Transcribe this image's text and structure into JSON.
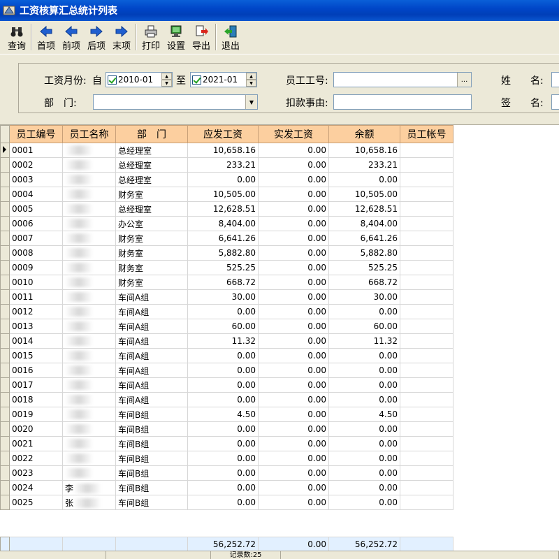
{
  "window": {
    "title": "工资核算汇总统计列表"
  },
  "toolbar": {
    "buttons": [
      {
        "label": "查询",
        "icon": "binoculars-icon"
      },
      {
        "label": "首项",
        "icon": "arrow-left-icon"
      },
      {
        "label": "前项",
        "icon": "arrow-left-icon"
      },
      {
        "label": "后项",
        "icon": "arrow-right-icon"
      },
      {
        "label": "末项",
        "icon": "arrow-right-icon"
      },
      {
        "label": "打印",
        "icon": "printer-icon"
      },
      {
        "label": "设置",
        "icon": "monitor-icon"
      },
      {
        "label": "导出",
        "icon": "export-icon"
      },
      {
        "label": "退出",
        "icon": "exit-door-icon"
      }
    ]
  },
  "filter": {
    "month_label": "工资月份:",
    "from_label": "自",
    "from_value": "2010-01",
    "to_label": "至",
    "to_value": "2021-01",
    "dept_label": "部　门:",
    "dept_value": "",
    "emp_no_label": "员工工号:",
    "emp_no_value": "",
    "deduct_label": "扣款事由:",
    "deduct_value": "",
    "name_label": "姓　　名:",
    "sign_label": "签　　名:",
    "dots": "..."
  },
  "table": {
    "columns": [
      "员工编号",
      "员工名称",
      "部　门",
      "应发工资",
      "实发工资",
      "余额",
      "员工帐号"
    ],
    "rows": [
      {
        "id": "0001",
        "name": "",
        "dept": "总经理室",
        "payable": "10,658.16",
        "paid": "0.00",
        "balance": "10,658.16"
      },
      {
        "id": "0002",
        "name": "",
        "dept": "总经理室",
        "payable": "233.21",
        "paid": "0.00",
        "balance": "233.21"
      },
      {
        "id": "0003",
        "name": "",
        "dept": "总经理室",
        "payable": "0.00",
        "paid": "0.00",
        "balance": "0.00"
      },
      {
        "id": "0004",
        "name": "",
        "dept": "财务室",
        "payable": "10,505.00",
        "paid": "0.00",
        "balance": "10,505.00"
      },
      {
        "id": "0005",
        "name": "",
        "dept": "总经理室",
        "payable": "12,628.51",
        "paid": "0.00",
        "balance": "12,628.51"
      },
      {
        "id": "0006",
        "name": "",
        "dept": "办公室",
        "payable": "8,404.00",
        "paid": "0.00",
        "balance": "8,404.00"
      },
      {
        "id": "0007",
        "name": "",
        "dept": "财务室",
        "payable": "6,641.26",
        "paid": "0.00",
        "balance": "6,641.26"
      },
      {
        "id": "0008",
        "name": "",
        "dept": "财务室",
        "payable": "5,882.80",
        "paid": "0.00",
        "balance": "5,882.80"
      },
      {
        "id": "0009",
        "name": "",
        "dept": "财务室",
        "payable": "525.25",
        "paid": "0.00",
        "balance": "525.25"
      },
      {
        "id": "0010",
        "name": "",
        "dept": "财务室",
        "payable": "668.72",
        "paid": "0.00",
        "balance": "668.72"
      },
      {
        "id": "0011",
        "name": "",
        "dept": "车间A组",
        "payable": "30.00",
        "paid": "0.00",
        "balance": "30.00"
      },
      {
        "id": "0012",
        "name": "",
        "dept": "车间A组",
        "payable": "0.00",
        "paid": "0.00",
        "balance": "0.00"
      },
      {
        "id": "0013",
        "name": "",
        "dept": "车间A组",
        "payable": "60.00",
        "paid": "0.00",
        "balance": "60.00"
      },
      {
        "id": "0014",
        "name": "",
        "dept": "车间A组",
        "payable": "11.32",
        "paid": "0.00",
        "balance": "11.32"
      },
      {
        "id": "0015",
        "name": "",
        "dept": "车间A组",
        "payable": "0.00",
        "paid": "0.00",
        "balance": "0.00"
      },
      {
        "id": "0016",
        "name": "",
        "dept": "车间A组",
        "payable": "0.00",
        "paid": "0.00",
        "balance": "0.00"
      },
      {
        "id": "0017",
        "name": "",
        "dept": "车间A组",
        "payable": "0.00",
        "paid": "0.00",
        "balance": "0.00"
      },
      {
        "id": "0018",
        "name": "",
        "dept": "车间A组",
        "payable": "0.00",
        "paid": "0.00",
        "balance": "0.00"
      },
      {
        "id": "0019",
        "name": "",
        "dept": "车间B组",
        "payable": "4.50",
        "paid": "0.00",
        "balance": "4.50"
      },
      {
        "id": "0020",
        "name": "",
        "dept": "车间B组",
        "payable": "0.00",
        "paid": "0.00",
        "balance": "0.00"
      },
      {
        "id": "0021",
        "name": "",
        "dept": "车间B组",
        "payable": "0.00",
        "paid": "0.00",
        "balance": "0.00"
      },
      {
        "id": "0022",
        "name": "",
        "dept": "车间B组",
        "payable": "0.00",
        "paid": "0.00",
        "balance": "0.00"
      },
      {
        "id": "0023",
        "name": "",
        "dept": "车间B组",
        "payable": "0.00",
        "paid": "0.00",
        "balance": "0.00"
      },
      {
        "id": "0024",
        "name": "李",
        "dept": "车间B组",
        "payable": "0.00",
        "paid": "0.00",
        "balance": "0.00"
      },
      {
        "id": "0025",
        "name": "张",
        "dept": "车间B组",
        "payable": "0.00",
        "paid": "0.00",
        "balance": "0.00"
      }
    ],
    "totals": {
      "payable": "56,252.72",
      "paid": "0.00",
      "balance": "56,252.72"
    }
  },
  "status": {
    "record_count": "记录数:25"
  },
  "colors": {
    "header_bg": "#fccf9f",
    "title_bar": "#0046c8",
    "totals_bg": "#e2f0ff"
  }
}
